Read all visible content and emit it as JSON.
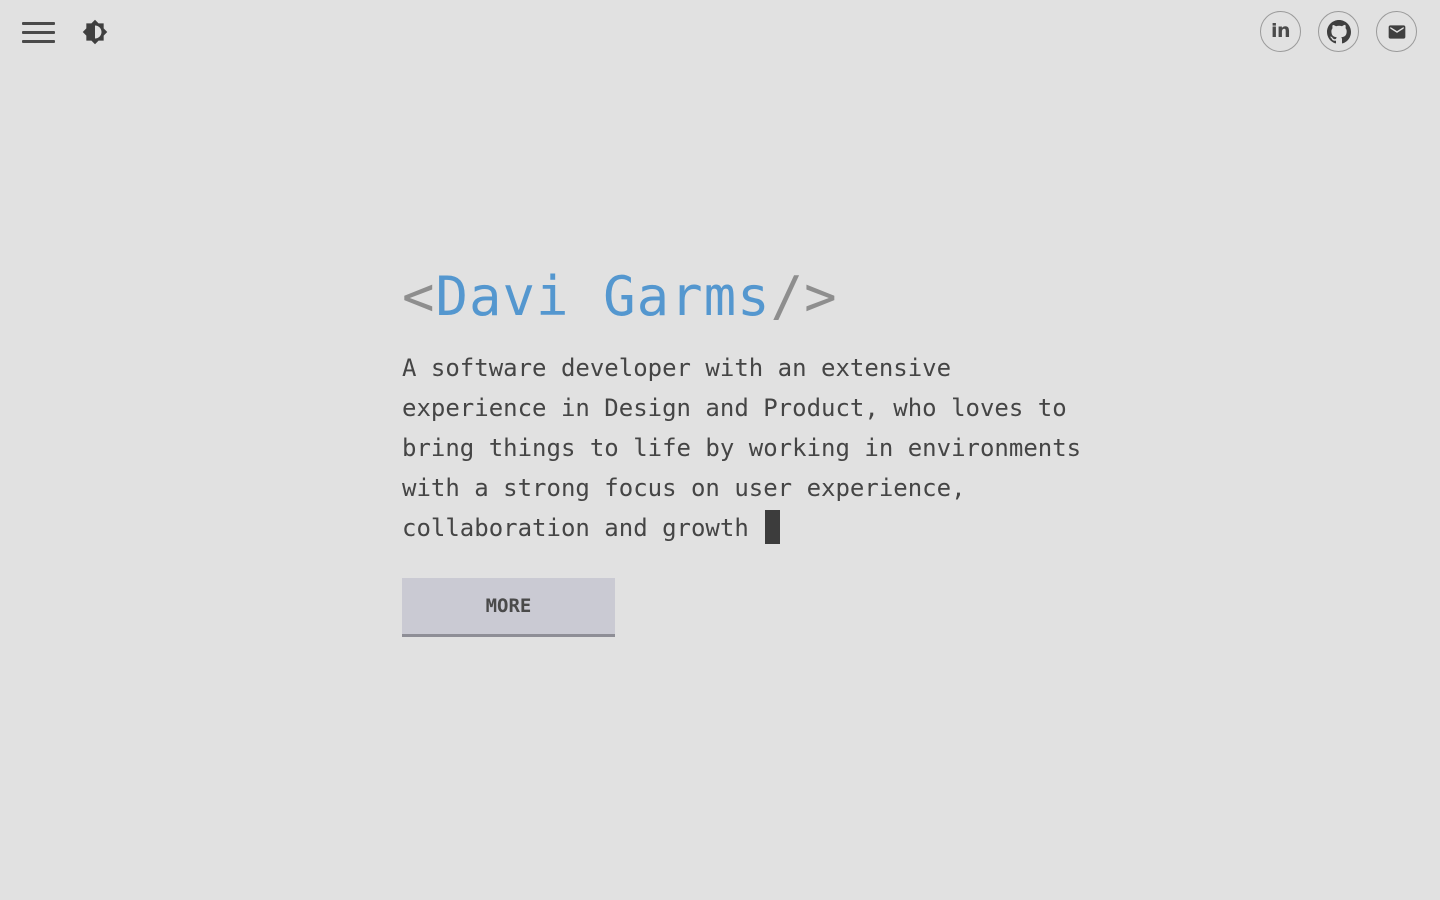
{
  "nav": {
    "menu_icon": "hamburger-menu-icon",
    "theme_icon": "brightness-contrast-icon"
  },
  "social": {
    "linkedin_text": "in",
    "linkedin_icon": "linkedin-icon",
    "github_icon": "github-icon",
    "email_icon": "mail-icon"
  },
  "hero": {
    "bracket_open": "<",
    "name": "Davi Garms",
    "bracket_close": "/>",
    "bio": "A software developer with an extensive experience in Design and Product, who loves to bring things to life by working in environments with a strong focus on user experience, collaboration and growth ",
    "more_label": "MORE"
  },
  "colors": {
    "background": "#e1e1e1",
    "accent": "#5497cf",
    "bracket": "#8e8e8e",
    "text": "#454545",
    "button_bg": "#cacad3"
  }
}
